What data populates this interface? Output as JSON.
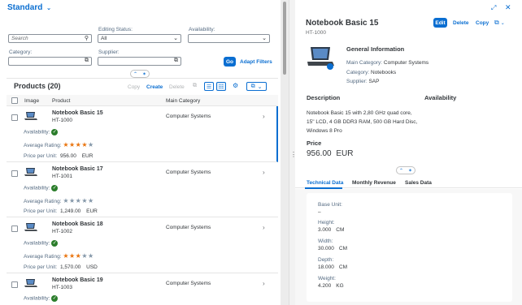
{
  "header": {
    "variant": "Standard"
  },
  "filters": {
    "search_placeholder": "Search",
    "editing_status_label": "Editing Status:",
    "editing_status_value": "All",
    "availability_label": "Availability:",
    "category_label": "Category:",
    "supplier_label": "Supplier:",
    "go": "Go",
    "adapt": "Adapt Filters"
  },
  "table": {
    "title": "Products (20)",
    "toolbar": {
      "copy": "Copy",
      "create": "Create",
      "delete": "Delete"
    },
    "columns": [
      "Image",
      "Product",
      "Main Category"
    ],
    "rows": [
      {
        "name": "Notebook Basic 15",
        "id": "HT-1000",
        "category": "Computer Systems",
        "availability_label": "Availability:",
        "rating_label": "Average Rating:",
        "rating": 3.5,
        "price_label": "Price per Unit:",
        "price": "956.00",
        "currency": "EUR"
      },
      {
        "name": "Notebook Basic 17",
        "id": "HT-1001",
        "category": "Computer Systems",
        "availability_label": "Availability:",
        "rating_label": "Average Rating:",
        "rating": 0,
        "price_label": "Price per Unit:",
        "price": "1,249.00",
        "currency": "EUR"
      },
      {
        "name": "Notebook Basic 18",
        "id": "HT-1002",
        "category": "Computer Systems",
        "availability_label": "Availability:",
        "rating_label": "Average Rating:",
        "rating": 3,
        "price_label": "Price per Unit:",
        "price": "1,570.00",
        "currency": "USD"
      },
      {
        "name": "Notebook Basic 19",
        "id": "HT-1003",
        "category": "Computer Systems",
        "availability_label": "Availability:"
      }
    ]
  },
  "detail": {
    "title": "Notebook Basic 15",
    "subtitle": "HT-1000",
    "actions": {
      "edit": "Edit",
      "delete": "Delete",
      "copy": "Copy"
    },
    "general": {
      "heading": "General Information",
      "main_category_label": "Main Category:",
      "main_category": "Computer Systems",
      "category_label": "Category:",
      "category": "Notebooks",
      "supplier_label": "Supplier:",
      "supplier": "SAP"
    },
    "description_heading": "Description",
    "availability_heading": "Availability",
    "description": [
      "Notebook Basic 15 with 2,80 GHz quad core,",
      "15\" LCD, 4 GB DDR3 RAM, 500 GB Hard Disc,",
      "Windows 8 Pro"
    ],
    "price_heading": "Price",
    "price": "956.00",
    "currency": "EUR",
    "tabs": [
      "Technical Data",
      "Monthly Revenue",
      "Sales Data"
    ],
    "tech": {
      "base_unit_label": "Base Unit:",
      "base_unit": "–",
      "height_label": "Height:",
      "height": "3.000",
      "height_unit": "CM",
      "width_label": "Width:",
      "width": "30.000",
      "width_unit": "CM",
      "depth_label": "Depth:",
      "depth": "18.000",
      "depth_unit": "CM",
      "weight_label": "Weight:",
      "weight": "4.200",
      "weight_unit": "KG"
    }
  },
  "colors": {
    "brand": "#0a6ed1",
    "star": "#e9730c",
    "positive": "#2b7d2b"
  }
}
